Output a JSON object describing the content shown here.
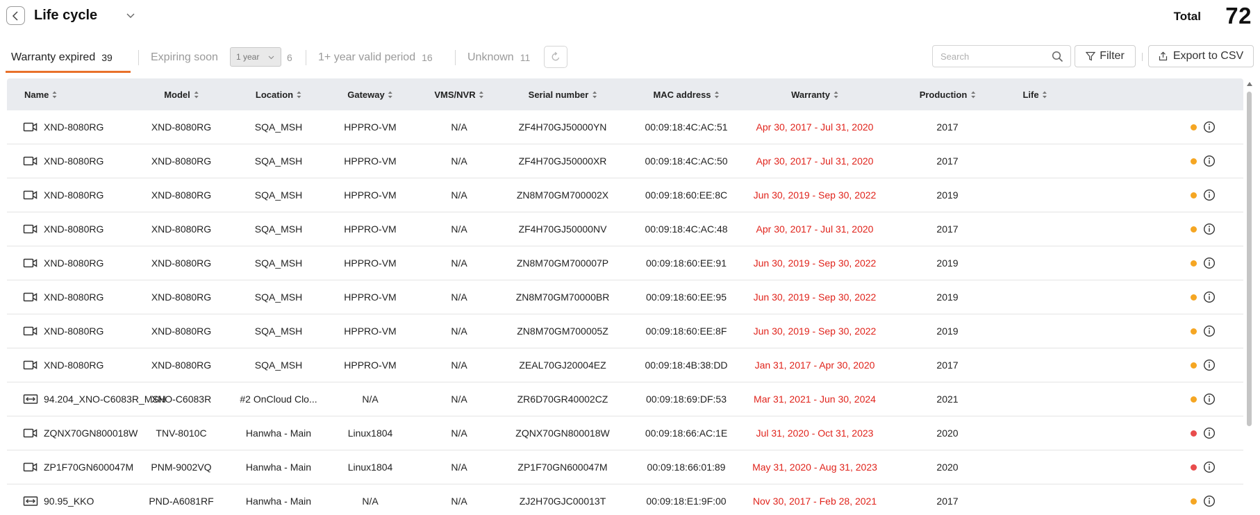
{
  "header": {
    "title": "Life cycle",
    "total_label": "Total",
    "total_value": "72"
  },
  "tabs": [
    {
      "label": "Warranty expired",
      "count": "39",
      "active": true
    },
    {
      "label": "Expiring soon",
      "count": "6",
      "active": false
    },
    {
      "label": "1+ year valid period",
      "count": "16",
      "active": false
    },
    {
      "label": "Unknown",
      "count": "11",
      "active": false
    }
  ],
  "period_select": {
    "value": "1 year"
  },
  "search": {
    "placeholder": "Search"
  },
  "toolbar": {
    "filter_label": "Filter",
    "export_label": "Export to CSV"
  },
  "columns": [
    "Name",
    "Model",
    "Location",
    "Gateway",
    "VMS/NVR",
    "Serial number",
    "MAC address",
    "Warranty",
    "Production",
    "Life"
  ],
  "status_colors": {
    "expiring": "#f5a623",
    "expired": "#e84c4c"
  },
  "accent_color": "#e8702a",
  "rows": [
    {
      "icon": "camera-icon",
      "name": "XND-8080RG",
      "model": "XND-8080RG",
      "location": "SQA_MSH",
      "gateway": "HPPRO-VM",
      "vms": "N/A",
      "serial": "ZF4H70GJ50000YN",
      "mac": "00:09:18:4C:AC:51",
      "warranty": "Apr 30, 2017 - Jul 31, 2020",
      "production": "2017",
      "life_status": "expiring"
    },
    {
      "icon": "camera-icon",
      "name": "XND-8080RG",
      "model": "XND-8080RG",
      "location": "SQA_MSH",
      "gateway": "HPPRO-VM",
      "vms": "N/A",
      "serial": "ZF4H70GJ50000XR",
      "mac": "00:09:18:4C:AC:50",
      "warranty": "Apr 30, 2017 - Jul 31, 2020",
      "production": "2017",
      "life_status": "expiring"
    },
    {
      "icon": "camera-icon",
      "name": "XND-8080RG",
      "model": "XND-8080RG",
      "location": "SQA_MSH",
      "gateway": "HPPRO-VM",
      "vms": "N/A",
      "serial": "ZN8M70GM700002X",
      "mac": "00:09:18:60:EE:8C",
      "warranty": "Jun 30, 2019 - Sep 30, 2022",
      "production": "2019",
      "life_status": "expiring"
    },
    {
      "icon": "camera-icon",
      "name": "XND-8080RG",
      "model": "XND-8080RG",
      "location": "SQA_MSH",
      "gateway": "HPPRO-VM",
      "vms": "N/A",
      "serial": "ZF4H70GJ50000NV",
      "mac": "00:09:18:4C:AC:48",
      "warranty": "Apr 30, 2017 - Jul 31, 2020",
      "production": "2017",
      "life_status": "expiring"
    },
    {
      "icon": "camera-icon",
      "name": "XND-8080RG",
      "model": "XND-8080RG",
      "location": "SQA_MSH",
      "gateway": "HPPRO-VM",
      "vms": "N/A",
      "serial": "ZN8M70GM700007P",
      "mac": "00:09:18:60:EE:91",
      "warranty": "Jun 30, 2019 - Sep 30, 2022",
      "production": "2019",
      "life_status": "expiring"
    },
    {
      "icon": "camera-icon",
      "name": "XND-8080RG",
      "model": "XND-8080RG",
      "location": "SQA_MSH",
      "gateway": "HPPRO-VM",
      "vms": "N/A",
      "serial": "ZN8M70GM70000BR",
      "mac": "00:09:18:60:EE:95",
      "warranty": "Jun 30, 2019 - Sep 30, 2022",
      "production": "2019",
      "life_status": "expiring"
    },
    {
      "icon": "camera-icon",
      "name": "XND-8080RG",
      "model": "XND-8080RG",
      "location": "SQA_MSH",
      "gateway": "HPPRO-VM",
      "vms": "N/A",
      "serial": "ZN8M70GM700005Z",
      "mac": "00:09:18:60:EE:8F",
      "warranty": "Jun 30, 2019 - Sep 30, 2022",
      "production": "2019",
      "life_status": "expiring"
    },
    {
      "icon": "camera-icon",
      "name": "XND-8080RG",
      "model": "XND-8080RG",
      "location": "SQA_MSH",
      "gateway": "HPPRO-VM",
      "vms": "N/A",
      "serial": "ZEAL70GJ20004EZ",
      "mac": "00:09:18:4B:38:DD",
      "warranty": "Jan 31, 2017 - Apr 30, 2020",
      "production": "2017",
      "life_status": "expiring"
    },
    {
      "icon": "multi-sensor-camera-icon",
      "name": "94.204_XNO-C6083R_MSH",
      "model": "XNO-C6083R",
      "location": "#2 OnCloud Clo...",
      "gateway": "N/A",
      "vms": "N/A",
      "serial": "ZR6D70GR40002CZ",
      "mac": "00:09:18:69:DF:53",
      "warranty": "Mar 31, 2021 - Jun 30, 2024",
      "production": "2021",
      "life_status": "expiring"
    },
    {
      "icon": "camera-icon",
      "name": "ZQNX70GN800018W",
      "model": "TNV-8010C",
      "location": "Hanwha - Main",
      "gateway": "Linux1804",
      "vms": "N/A",
      "serial": "ZQNX70GN800018W",
      "mac": "00:09:18:66:AC:1E",
      "warranty": "Jul 31, 2020 - Oct 31, 2023",
      "production": "2020",
      "life_status": "expired"
    },
    {
      "icon": "camera-icon",
      "name": "ZP1F70GN600047M",
      "model": "PNM-9002VQ",
      "location": "Hanwha - Main",
      "gateway": "Linux1804",
      "vms": "N/A",
      "serial": "ZP1F70GN600047M",
      "mac": "00:09:18:66:01:89",
      "warranty": "May 31, 2020 - Aug 31, 2023",
      "production": "2020",
      "life_status": "expired"
    },
    {
      "icon": "multi-sensor-camera-icon",
      "name": "90.95_KKO",
      "model": "PND-A6081RF",
      "location": "Hanwha - Main",
      "gateway": "N/A",
      "vms": "N/A",
      "serial": "ZJ2H70GJC00013T",
      "mac": "00:09:18:E1:9F:00",
      "warranty": "Nov 30, 2017 - Feb 28, 2021",
      "production": "2017",
      "life_status": "expiring"
    }
  ]
}
